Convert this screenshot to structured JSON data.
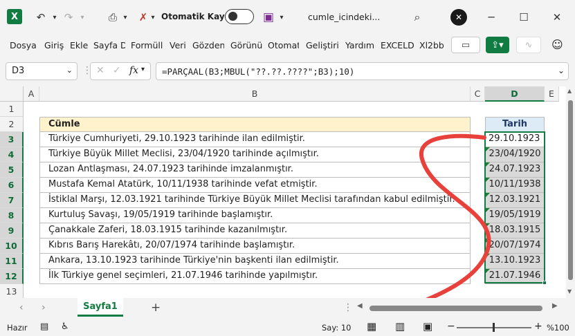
{
  "titlebar": {
    "autosave_label": "Otomatik Kaydet",
    "filename": "cumle_icindeki...",
    "app_logo_letter": "X",
    "accent": "#107c41"
  },
  "ribbon": {
    "tabs": [
      "Dosya",
      "Giriş",
      "Ekle",
      "Sayfa Dü",
      "Formülle",
      "Veri",
      "Gözden",
      "Görünür",
      "Otomati",
      "Geliştiric",
      "Yardım",
      "EXCELD",
      "Xl2bb"
    ]
  },
  "formula_bar": {
    "name_box": "D3",
    "fx_label": "fx",
    "formula": "=PARÇAAL(B3;MBUL(\"??.??.????\";B3);10)"
  },
  "grid": {
    "columns": [
      "A",
      "B",
      "C",
      "D",
      "E"
    ],
    "rows": [
      "1",
      "2",
      "3",
      "4",
      "5",
      "6",
      "7",
      "8",
      "9",
      "10",
      "11",
      "12",
      "13"
    ],
    "header_b": "Cümle",
    "header_d": "Tarih",
    "sentences": [
      "Türkiye Cumhuriyeti, 29.10.1923 tarihinde ilan edilmiştir.",
      "Türkiye Büyük Millet Meclisi, 23/04/1920 tarihinde açılmıştır.",
      "Lozan Antlaşması, 24.07.1923 tarihinde imzalanmıştır.",
      "Mustafa Kemal Atatürk, 10/11/1938 tarihinde vefat etmiştir.",
      "İstiklal Marşı, 12.03.1921 tarihinde Türkiye Büyük Millet Meclisi tarafından kabul edilmiştir.",
      "Kurtuluş Savaşı, 19/05/1919 tarihinde başlamıştır.",
      "Çanakkale Zaferi, 18.03.1915 tarihinde kazanılmıştır.",
      "Kıbrıs Barış Harekâtı, 20/07/1974 tarihinde başlamıştır.",
      "Ankara, 13.10.1923 tarihinde Türkiye'nin başkenti ilan edilmiştir.",
      "İlk Türkiye genel seçimleri, 21.07.1946 tarihinde yapılmıştır."
    ],
    "dates": [
      "29.10.1923",
      "23/04/1920",
      "24.07.1923",
      "10/11/1938",
      "12.03.1921",
      "19/05/1919",
      "18.03.1915",
      "20/07/1974",
      "13.10.1923",
      "21.07.1946"
    ]
  },
  "sheets": {
    "active": "Sayfa1",
    "add_label": "+"
  },
  "status": {
    "ready": "Hazır",
    "count": "Say: 10",
    "zoom": "%100",
    "minus": "−",
    "plus": "+"
  },
  "colors": {
    "header_fill": "#fff2cc",
    "tarih_fill": "#ddebf7",
    "selection": "#107c41",
    "arrow": "#e8413c"
  }
}
